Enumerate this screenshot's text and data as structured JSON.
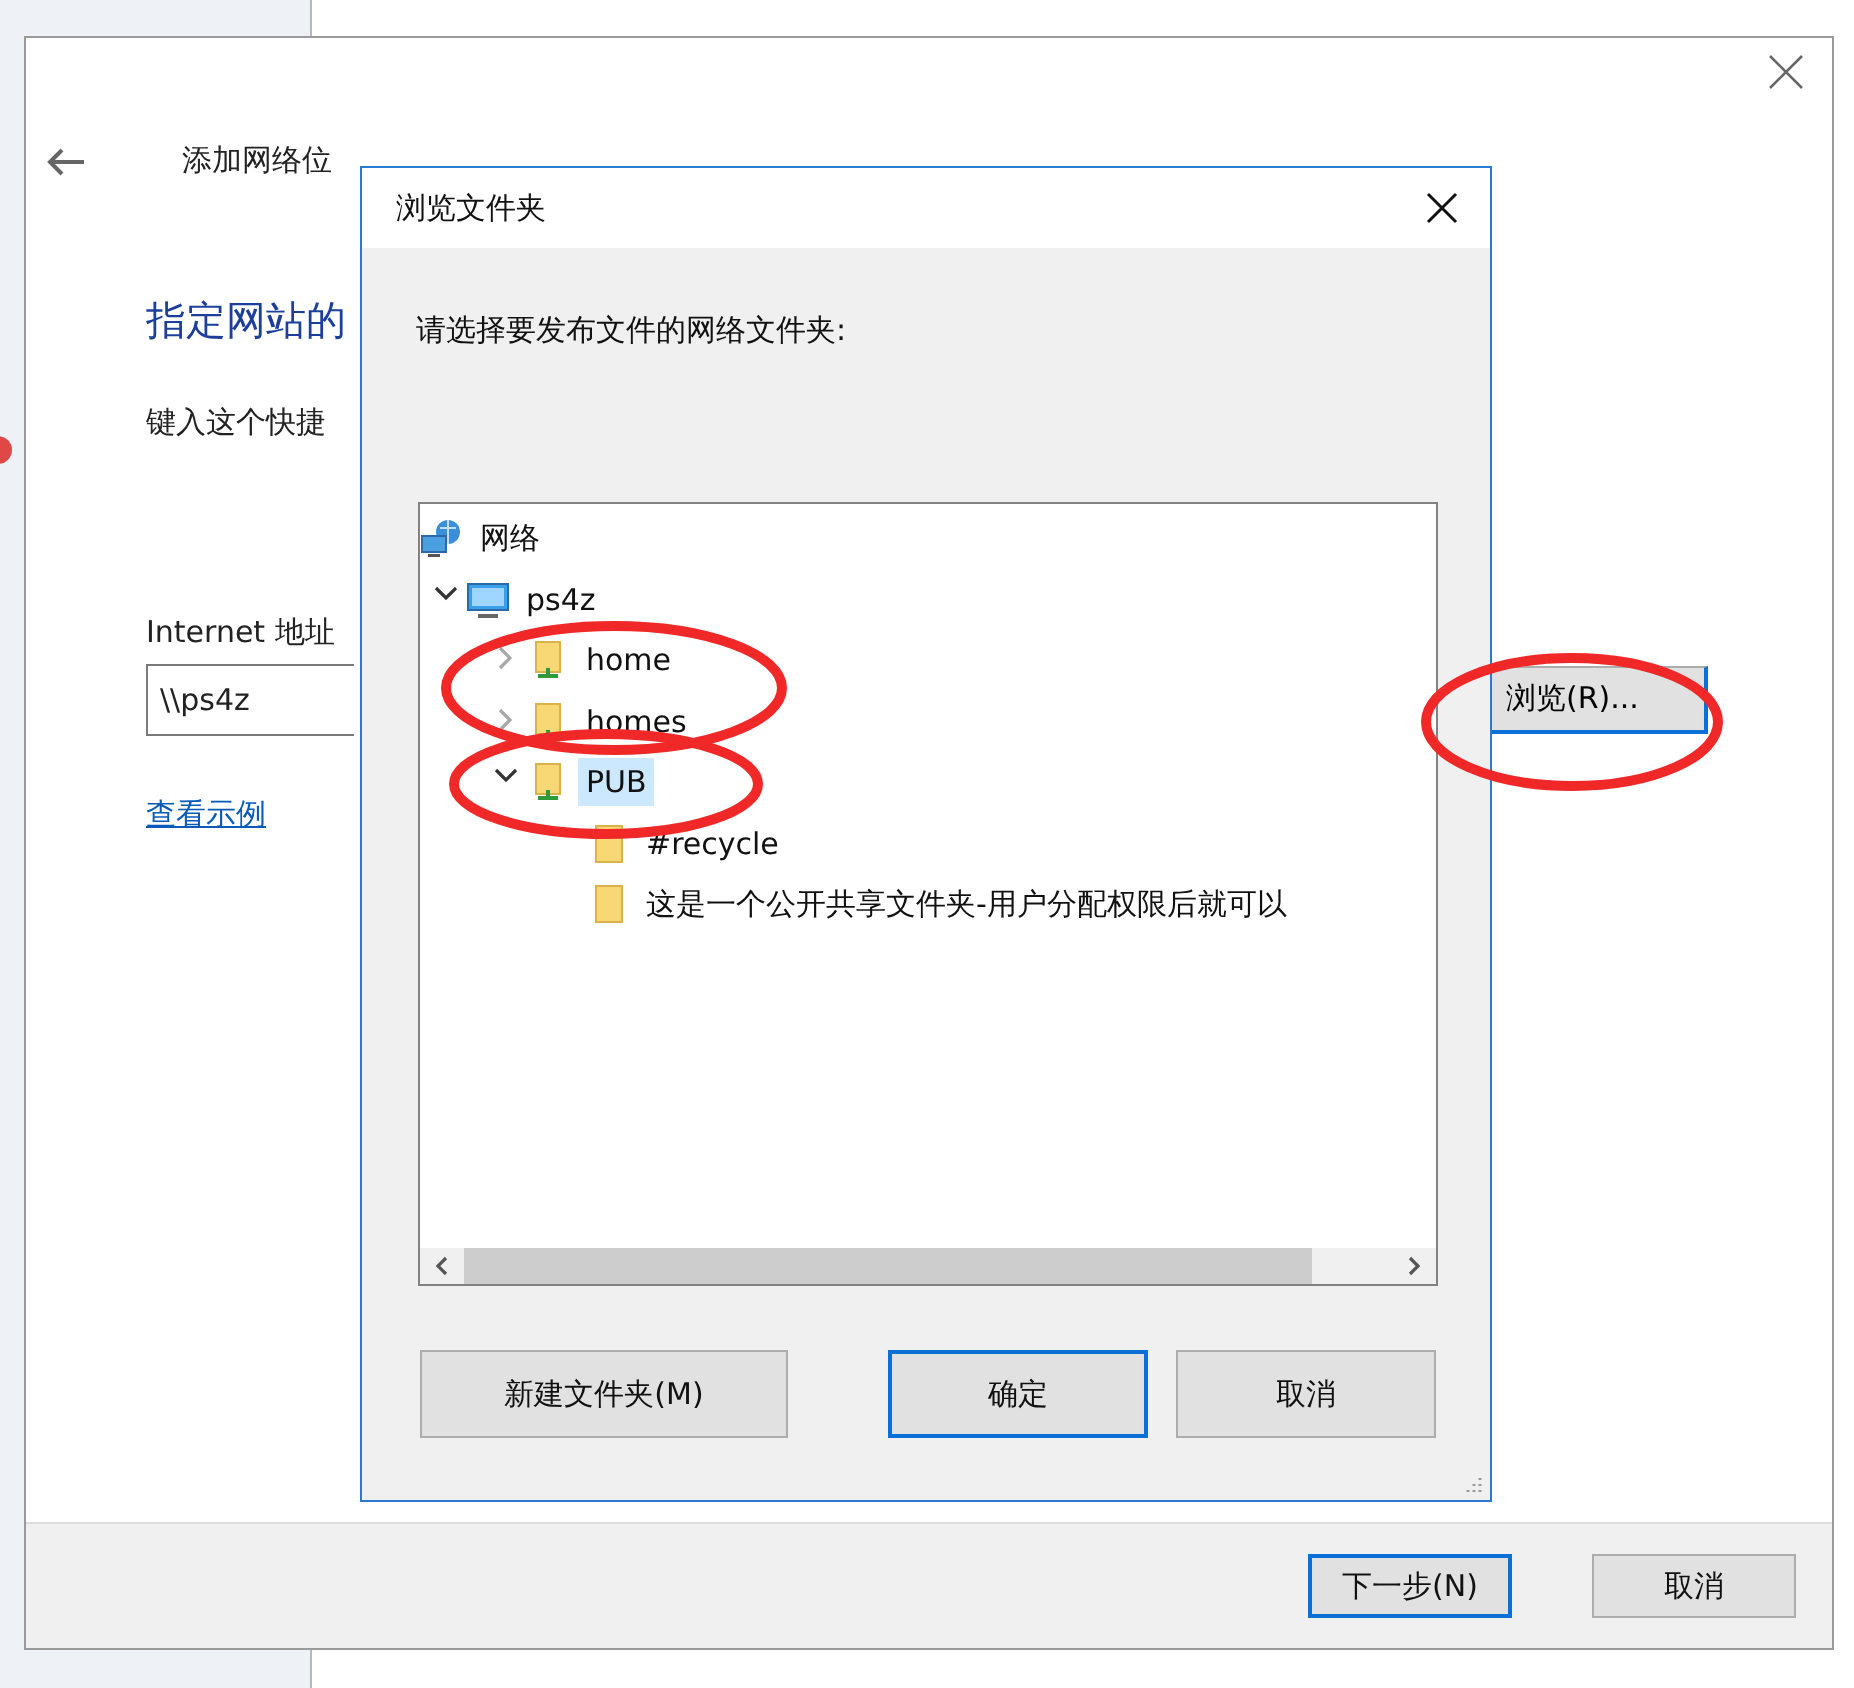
{
  "wizard": {
    "title": "添加网络位",
    "heading": "指定网站的",
    "instruction": "键入这个快捷",
    "address_label": "Internet 地址",
    "address_value": "\\\\ps4z",
    "example_link": "查看示例",
    "browse_button": "浏览(R)...",
    "buttons": [
      {
        "label": "下一步(N)",
        "default": true
      },
      {
        "label": "取消",
        "default": false
      }
    ]
  },
  "dialog": {
    "title": "浏览文件夹",
    "prompt": "请选择要发布文件的网络文件夹:",
    "tree": [
      {
        "label": "网络",
        "kind": "network",
        "selected": false,
        "children": [
          {
            "label": "ps4z",
            "kind": "computer",
            "expanded": true,
            "selected": false,
            "children": [
              {
                "label": "home",
                "kind": "share",
                "expanded": false,
                "selected": false
              },
              {
                "label": "homes",
                "kind": "share",
                "expanded": false,
                "selected": false
              },
              {
                "label": "PUB",
                "kind": "share",
                "expanded": true,
                "selected": true,
                "children": [
                  {
                    "label": "#recycle",
                    "kind": "folder",
                    "selected": false
                  },
                  {
                    "label": "这是一个公开共享文件夹-用户分配权限后就可以",
                    "kind": "folder",
                    "selected": false
                  }
                ]
              }
            ]
          }
        ]
      }
    ],
    "buttons": [
      {
        "label": "新建文件夹(M)",
        "default": false
      },
      {
        "label": "确定",
        "default": true
      },
      {
        "label": "取消",
        "default": false
      }
    ]
  }
}
